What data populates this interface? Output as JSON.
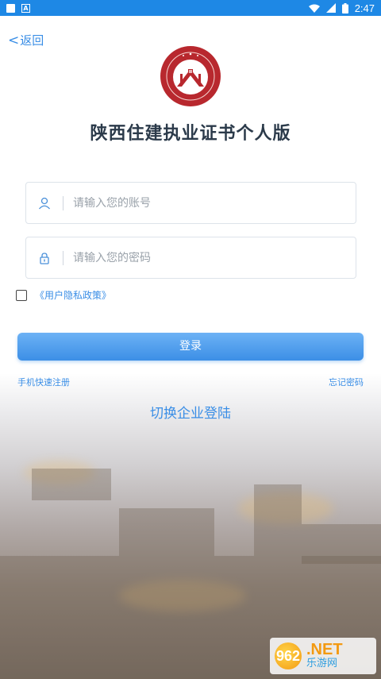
{
  "status_bar": {
    "time": "2:47",
    "icons": [
      "notification-square-icon",
      "a-badge-icon",
      "wifi-icon",
      "signal-icon",
      "battery-icon"
    ]
  },
  "header": {
    "back_label": "返回"
  },
  "logo": {
    "icon": "housing-construction-seal",
    "colors": {
      "ring": "#b8282e",
      "center": "#ffffff"
    }
  },
  "title": "陕西住建执业证书个人版",
  "form": {
    "account_placeholder": "请输入您的账号",
    "password_placeholder": "请输入您的密码",
    "account_value": "",
    "password_value": "",
    "policy_label": "《用户隐私政策》",
    "policy_checked": false,
    "login_label": "登录",
    "register_label": "手机快速注册",
    "forgot_label": "忘记密码",
    "switch_label": "切换企业登陆"
  },
  "watermark": {
    "badge_text": "962",
    "net_text": ".NET",
    "bottom_text": "乐游网"
  },
  "colors": {
    "accent": "#3a8ee6",
    "status_bar": "#1e88e5",
    "title_text": "#2b3a4a"
  }
}
